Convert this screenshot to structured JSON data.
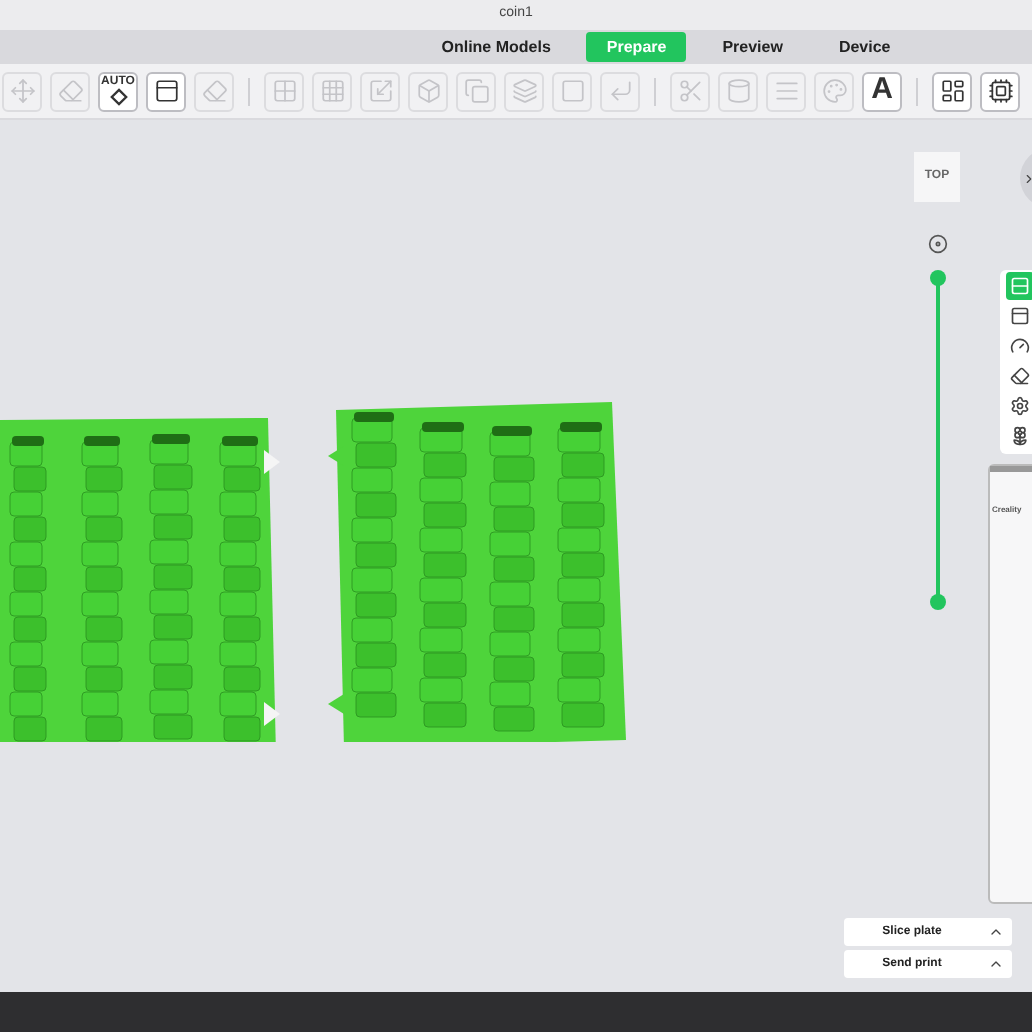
{
  "window": {
    "title": "coin1"
  },
  "tabs": [
    {
      "label": "Online Models",
      "selected": false
    },
    {
      "label": "Prepare",
      "selected": true
    },
    {
      "label": "Preview",
      "selected": false
    },
    {
      "label": "Device",
      "selected": false
    }
  ],
  "toolbar": {
    "groups": [
      [
        {
          "kind": "icon",
          "disabled": true
        },
        {
          "kind": "icon",
          "disabled": true
        },
        {
          "kind": "auto",
          "label": "AUTO",
          "disabled": false
        },
        {
          "kind": "icon",
          "disabled": false
        },
        {
          "kind": "icon",
          "disabled": true
        }
      ],
      [
        {
          "kind": "icon",
          "disabled": true
        },
        {
          "kind": "icon",
          "disabled": true
        },
        {
          "kind": "icon",
          "disabled": true
        },
        {
          "kind": "icon",
          "disabled": true
        },
        {
          "kind": "icon",
          "disabled": true
        },
        {
          "kind": "icon",
          "disabled": true
        },
        {
          "kind": "icon",
          "disabled": true
        },
        {
          "kind": "icon",
          "disabled": true
        }
      ],
      [
        {
          "kind": "icon",
          "disabled": true
        },
        {
          "kind": "icon",
          "disabled": true
        },
        {
          "kind": "icon",
          "disabled": true
        },
        {
          "kind": "icon",
          "disabled": true
        },
        {
          "kind": "letter",
          "label": "A",
          "disabled": false
        }
      ],
      [
        {
          "kind": "icon",
          "disabled": false
        },
        {
          "kind": "icon",
          "disabled": false
        }
      ]
    ]
  },
  "view_cube": {
    "label": "TOP"
  },
  "layer_slider": {
    "level": 1
  },
  "side_panel": {
    "items": [
      {
        "selected": true
      },
      {
        "selected": false
      },
      {
        "selected": false
      },
      {
        "selected": false
      },
      {
        "selected": false
      },
      {
        "selected": false
      }
    ]
  },
  "preview_card": {
    "title": "Creality"
  },
  "actions": [
    {
      "label": "Slice plate"
    },
    {
      "label": "Send print"
    }
  ]
}
